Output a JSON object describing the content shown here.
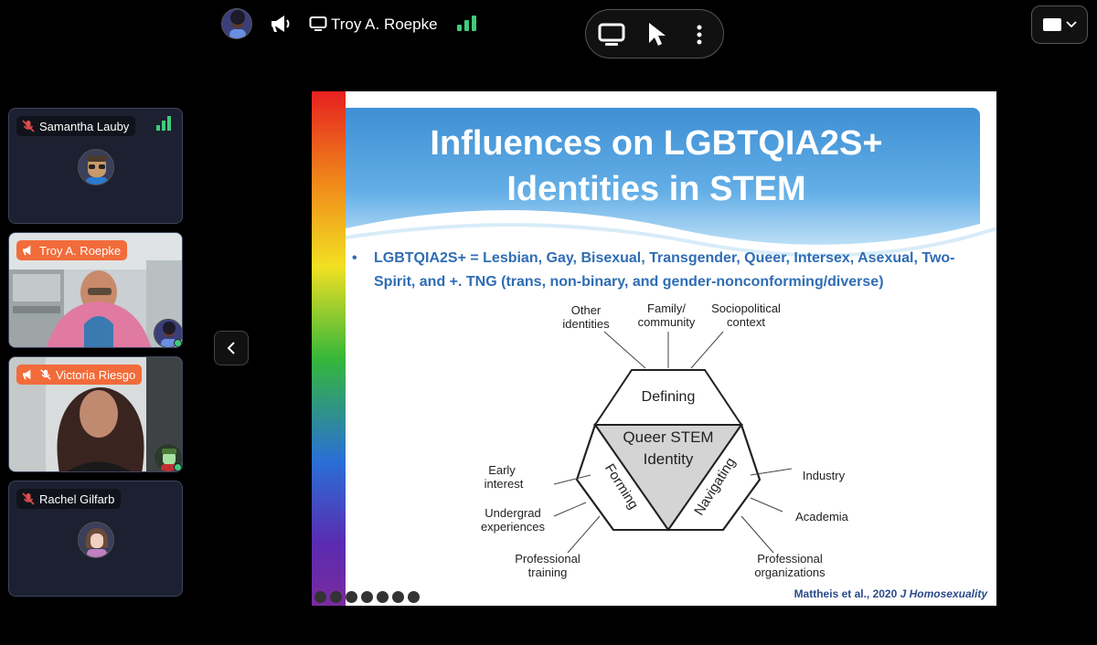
{
  "presenter": {
    "name": "Troy A. Roepke"
  },
  "participants": [
    {
      "name": "Samantha Lauby",
      "muted": true
    },
    {
      "name": "Troy A. Roepke",
      "muted": false
    },
    {
      "name": "Victoria Riesgo",
      "muted": true
    },
    {
      "name": "Rachel Gilfarb",
      "muted": true
    }
  ],
  "slide": {
    "title_line1": "Influences on LGBTQIA2S+",
    "title_line2": "Identities in STEM",
    "bullet": "LGBTQIA2S+ = Lesbian, Gay, Bisexual, Transgender, Queer, Intersex, Asexual, Two-Spirit, and +. TNG (trans, non-binary, and gender-nonconforming/diverse)",
    "diagram": {
      "center_line1": "Queer STEM",
      "center_line2": "Identity",
      "defining": "Defining",
      "forming": "Forming",
      "navigating": "Navigating",
      "labels": {
        "other_1": "Other",
        "other_2": "identities",
        "family_1": "Family/",
        "family_2": "community",
        "socio_1": "Sociopolitical",
        "socio_2": "context",
        "early_1": "Early",
        "early_2": "interest",
        "undergrad_1": "Undergrad",
        "undergrad_2": "experiences",
        "prof_training_1": "Professional",
        "prof_training_2": "training",
        "industry": "Industry",
        "academia": "Academia",
        "prof_org_1": "Professional",
        "prof_org_2": "organizations"
      }
    },
    "citation_prefix": "Mattheis et al., 2020 ",
    "citation_journal": "J Homosexuality"
  },
  "colors": {
    "accent_green": "#3ecb7a",
    "presenter_orange": "#f26b3a",
    "slide_blue": "#2f6db4"
  }
}
